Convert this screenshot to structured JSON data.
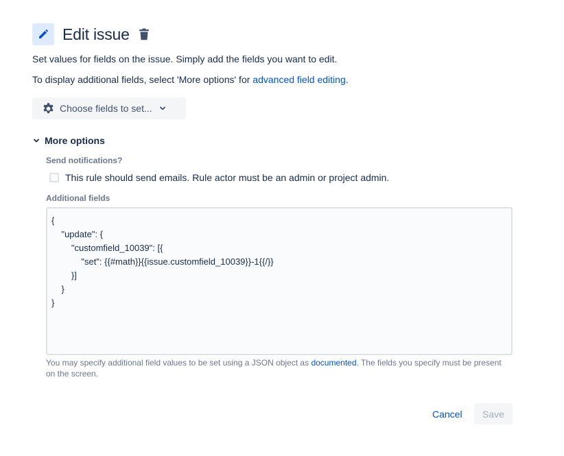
{
  "header": {
    "icon": "pencil-icon",
    "title": "Edit issue",
    "delete_icon": "trash-icon"
  },
  "description": {
    "line1": "Set values for fields on the issue. Simply add the fields you want to edit.",
    "line2_prefix": "To display additional fields, select 'More options' for ",
    "line2_link": "advanced field editing",
    "line2_suffix": "."
  },
  "choose_fields": {
    "icon": "gear-icon",
    "label": "Choose fields to set...",
    "chevron": "chevron-down-icon"
  },
  "more_options": {
    "chevron": "chevron-down-icon",
    "label": "More options",
    "send_notifications_label": "Send notifications?",
    "send_emails_checkbox_label": "This rule should send emails. Rule actor must be an admin or project admin.",
    "send_emails_checked": false,
    "additional_fields_label": "Additional fields",
    "additional_fields_value": "{\n\t\"update\": {\n\t\t\"customfield_10039\": [{\n\t\t\t\"set\": {{#math}}{{issue.customfield_10039}}-1{{/}}\n\t\t}]\n\t}\n}",
    "help_prefix": "You may specify additional field values to be set using a JSON object as ",
    "help_link": "documented",
    "help_suffix": ". The fields you specify must be present on the screen."
  },
  "footer": {
    "cancel_label": "Cancel",
    "save_label": "Save"
  },
  "colors": {
    "link": "#0052cc",
    "text": "#172b4d",
    "muted": "#6b778c",
    "header_icon_bg": "#deebff",
    "button_bg": "#f4f5f7",
    "disabled_text": "#a5adba"
  }
}
